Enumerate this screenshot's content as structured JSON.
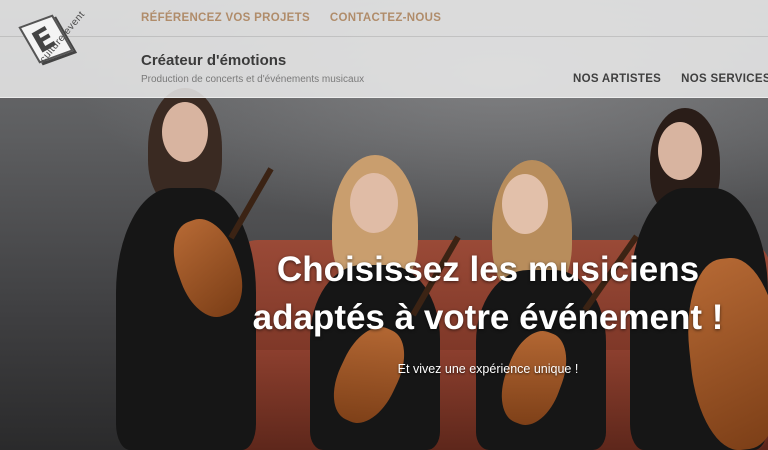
{
  "logo": {
    "letter": "E",
    "wordmark": "culture event"
  },
  "top_nav": [
    {
      "label": "RÉFÉRENCEZ VOS PROJETS"
    },
    {
      "label": "CONTACTEZ-NOUS"
    }
  ],
  "brand": {
    "title": "Créateur d'émotions",
    "subtitle": "Production de concerts et d'événements musicaux"
  },
  "main_nav": [
    {
      "label": "NOS ARTISTES"
    },
    {
      "label": "NOS SERVICES"
    }
  ],
  "hero": {
    "title_line1": "Choisissez les musiciens",
    "title_line2": "adaptés à votre événement !",
    "subtitle": "Et vivez une expérience unique !"
  },
  "colors": {
    "top_nav_link": "#b08c6a",
    "main_nav_link": "#3f3f3f",
    "header_bg": "#f0f0f0",
    "sofa": "#8c3f2e"
  }
}
